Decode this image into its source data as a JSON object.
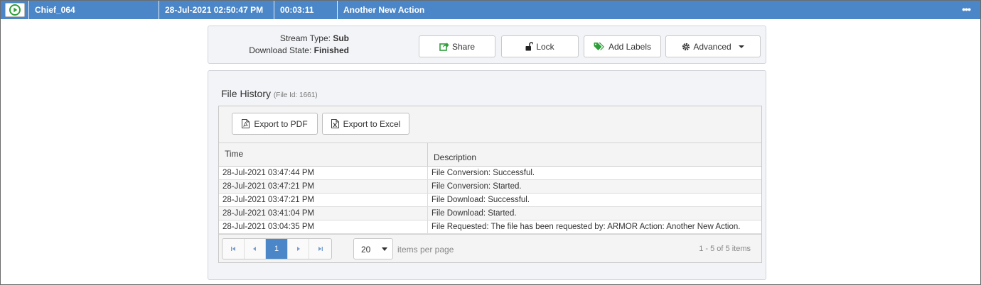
{
  "header": {
    "name": "Chief_064",
    "datetime": "28-Jul-2021 02:50:47 PM",
    "duration": "00:03:11",
    "action": "Another New Action",
    "more": "•••"
  },
  "info": {
    "stream_type_label": "Stream Type:",
    "stream_type_value": "Sub",
    "download_state_label": "Download State:",
    "download_state_value": "Finished"
  },
  "actions": {
    "share": "Share",
    "lock": "Lock",
    "add_labels": "Add Labels",
    "advanced": "Advanced"
  },
  "history": {
    "title": "File History",
    "file_id": "(File Id: 1661)",
    "export_pdf": "Export to PDF",
    "export_excel": "Export to Excel",
    "col_time": "Time",
    "col_desc": "Description",
    "rows": [
      {
        "time": "28-Jul-2021 03:47:44 PM",
        "desc": "File Conversion: Successful."
      },
      {
        "time": "28-Jul-2021 03:47:21 PM",
        "desc": "File Conversion: Started."
      },
      {
        "time": "28-Jul-2021 03:47:21 PM",
        "desc": "File Download: Successful."
      },
      {
        "time": "28-Jul-2021 03:41:04 PM",
        "desc": "File Download: Started."
      },
      {
        "time": "28-Jul-2021 03:04:35 PM",
        "desc": "File Requested: The file has been requested by: ARMOR Action: Another New Action."
      }
    ]
  },
  "pager": {
    "current_page": "1",
    "page_size": "20",
    "items_per_page": "items per page",
    "range": "1 - 5 of 5 items"
  },
  "colors": {
    "header_blue": "#4a86c8",
    "play_green": "#2e9e3a",
    "share_green": "#2e9e3a",
    "labels_green": "#2e9e3a"
  }
}
